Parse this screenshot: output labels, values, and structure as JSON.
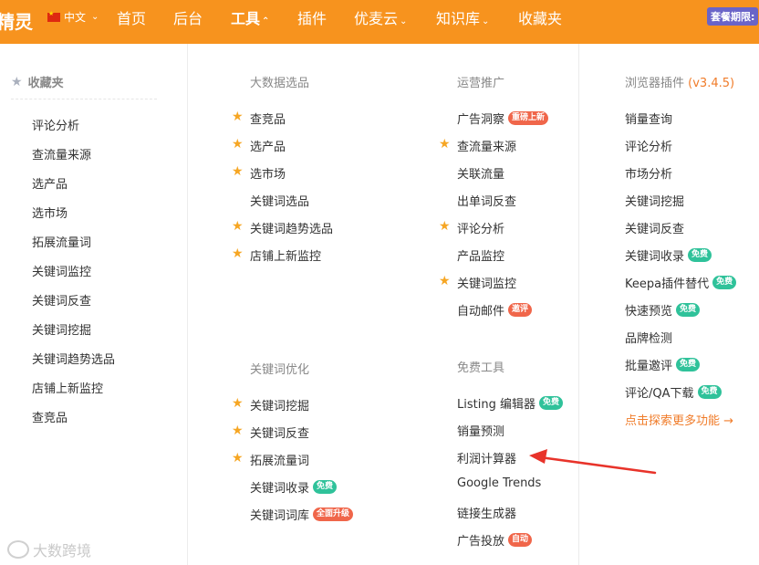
{
  "topbar": {
    "logo": "精灵",
    "language": "中文",
    "nav": [
      "首页",
      "后台",
      "工具",
      "插件",
      "优麦云",
      "知识库",
      "收藏夹"
    ],
    "plan_badge": "套餐期限:"
  },
  "sidebar": {
    "title": "收藏夹",
    "items": [
      "评论分析",
      "查流量来源",
      "选产品",
      "选市场",
      "拓展流量词",
      "关键词监控",
      "关键词反查",
      "关键词挖掘",
      "关键词趋势选品",
      "店铺上新监控",
      "查竞品"
    ]
  },
  "bigdata": {
    "title": "大数据选品",
    "items": [
      {
        "label": "查竞品"
      },
      {
        "label": "选产品"
      },
      {
        "label": "选市场"
      },
      {
        "label": "关键词选品"
      },
      {
        "label": "关键词趋势选品"
      },
      {
        "label": "店铺上新监控"
      }
    ]
  },
  "keyword": {
    "title": "关键词优化",
    "items": [
      {
        "label": "关键词挖掘"
      },
      {
        "label": "关键词反查"
      },
      {
        "label": "拓展流量词"
      },
      {
        "label": "关键词收录",
        "badge": "免费"
      },
      {
        "label": "关键词词库",
        "badge": "全面升级"
      }
    ]
  },
  "ops": {
    "title": "运营推广",
    "items": [
      {
        "label": "广告洞察",
        "badge": "重磅上新"
      },
      {
        "label": "查流量来源"
      },
      {
        "label": "关联流量"
      },
      {
        "label": "出单词反查"
      },
      {
        "label": "评论分析"
      },
      {
        "label": "产品监控"
      },
      {
        "label": "关键词监控"
      },
      {
        "label": "自动邮件",
        "badge": "邀评"
      }
    ]
  },
  "free": {
    "title": "免费工具",
    "items": [
      {
        "label": "Listing 编辑器",
        "badge": "免费"
      },
      {
        "label": "销量预测"
      },
      {
        "label": "利润计算器"
      },
      {
        "label": "Google Trends"
      },
      {
        "label": "链接生成器"
      },
      {
        "label": "广告投放",
        "badge": "自动"
      }
    ]
  },
  "browser": {
    "title": "浏览器插件",
    "version": "(v3.4.5)",
    "items": [
      {
        "label": "销量查询"
      },
      {
        "label": "评论分析"
      },
      {
        "label": "市场分析"
      },
      {
        "label": "关键词挖掘"
      },
      {
        "label": "关键词反查"
      },
      {
        "label": "关键词收录",
        "badge": "免费"
      },
      {
        "label": "Keepa插件替代",
        "badge": "免费"
      },
      {
        "label": "快速预览",
        "badge": "免费"
      },
      {
        "label": "品牌检测"
      },
      {
        "label": "批量邀评",
        "badge": "免费"
      },
      {
        "label": "评论/QA下载",
        "badge": "免费"
      }
    ],
    "more": "点击探索更多功能 →"
  },
  "watermark": "大数跨境",
  "colors": {
    "brand": "#f7931e",
    "badge_red": "#f0664a",
    "badge_green": "#2fc29a",
    "star": "#f6a623"
  }
}
